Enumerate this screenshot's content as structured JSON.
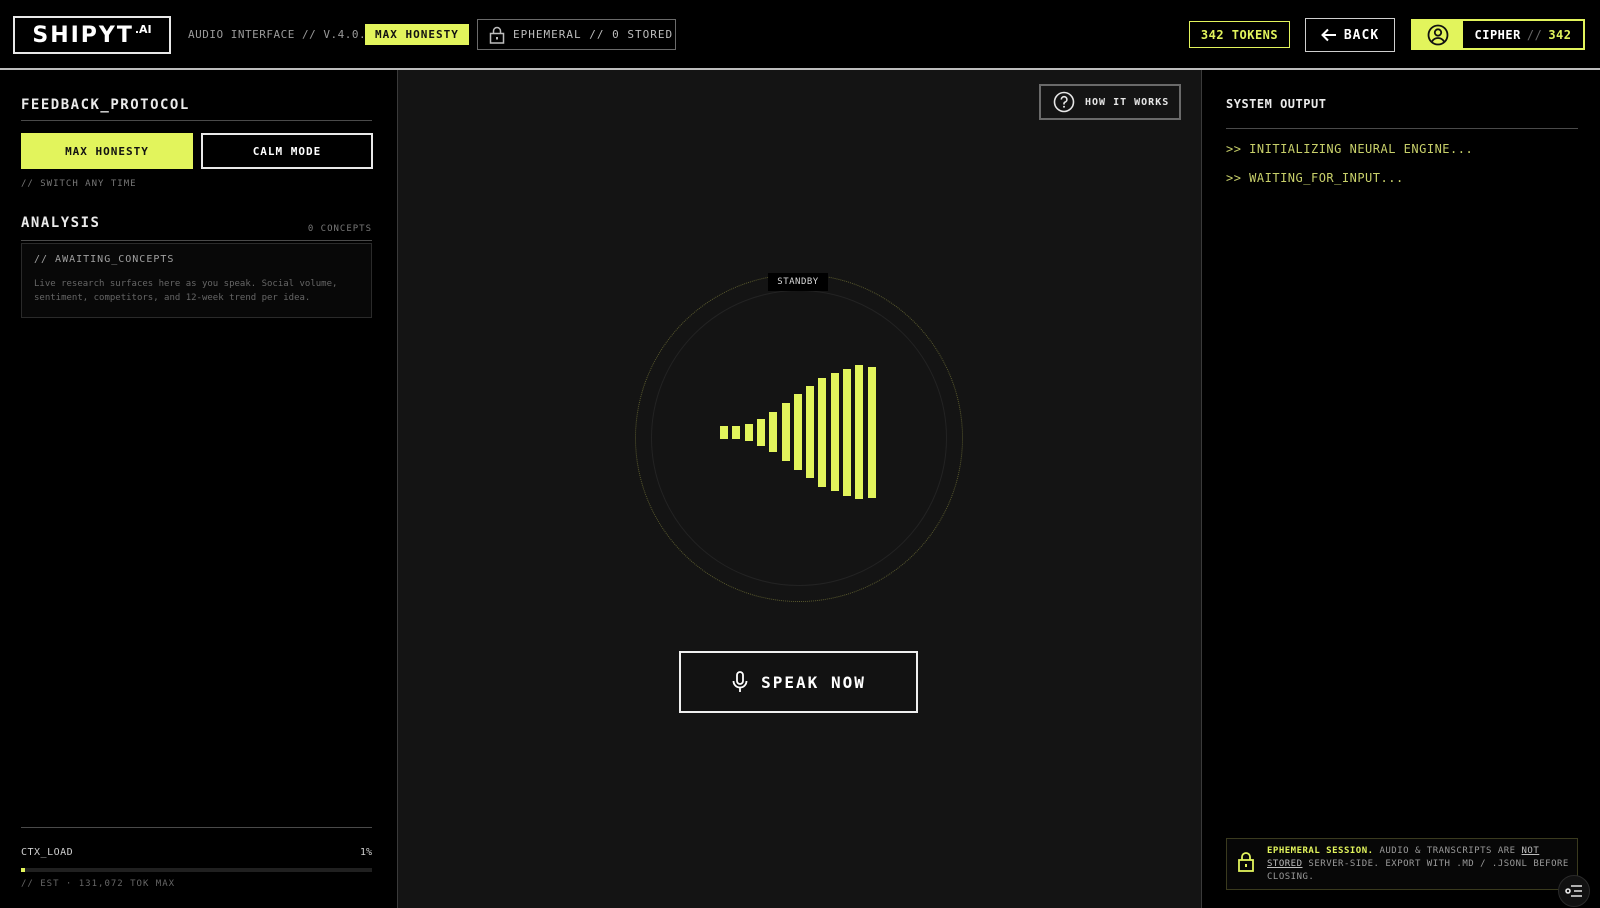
{
  "header": {
    "logo_main": "SHIPYT",
    "logo_sup": ".AI",
    "subtitle": "AUDIO INTERFACE // V.4.0.1",
    "mode_badge": "MAX HONESTY",
    "ephemeral_badge": "EPHEMERAL // 0 STORED",
    "tokens": "342 TOKENS",
    "back_label": "BACK",
    "user_name": "CIPHER",
    "user_sep": "//",
    "user_score": "342"
  },
  "left": {
    "protocol_title": "FEEDBACK_PROTOCOL",
    "mode_active": "MAX HONESTY",
    "mode_inactive": "CALM MODE",
    "switch_note": "// SWITCH ANY TIME",
    "analysis_title": "ANALYSIS",
    "concepts_count": "0 CONCEPTS",
    "awaiting_title": "// AWAITING_CONCEPTS",
    "awaiting_desc": "Live research surfaces here as you speak. Social volume, sentiment, competitors, and 12-week trend per idea.",
    "ctx_label": "CTX_LOAD",
    "ctx_pct": "1%",
    "ctx_value": 0.01,
    "ctx_est": "// EST · 131,072 TOK MAX"
  },
  "center": {
    "how_label": "HOW IT WORKS",
    "status": "STANDBY",
    "speak_label": "SPEAK NOW",
    "waveform_levels": [
      0.1,
      0.1,
      0.13,
      0.2,
      0.3,
      0.43,
      0.57,
      0.69,
      0.81,
      0.88,
      0.95,
      1.0,
      0.98
    ]
  },
  "right": {
    "title": "SYSTEM OUTPUT",
    "log": [
      ">> INITIALIZING NEURAL ENGINE...",
      ">> WAITING_FOR_INPUT..."
    ],
    "eph_strong": "EPHEMERAL SESSION.",
    "eph_text1": " AUDIO & TRANSCRIPTS ARE ",
    "eph_u1": "NOT",
    "eph_u2": "STORED",
    "eph_text2": " SERVER-SIDE. EXPORT WITH .MD / .JSONL BEFORE CLOSING."
  },
  "colors": {
    "accent": "#e2f45c",
    "background": "#000000",
    "panel": "#141414"
  },
  "icons": [
    "lock-icon",
    "arrow-left-icon",
    "user-circle-icon",
    "help-circle-icon",
    "mic-icon",
    "list-settings-icon"
  ]
}
